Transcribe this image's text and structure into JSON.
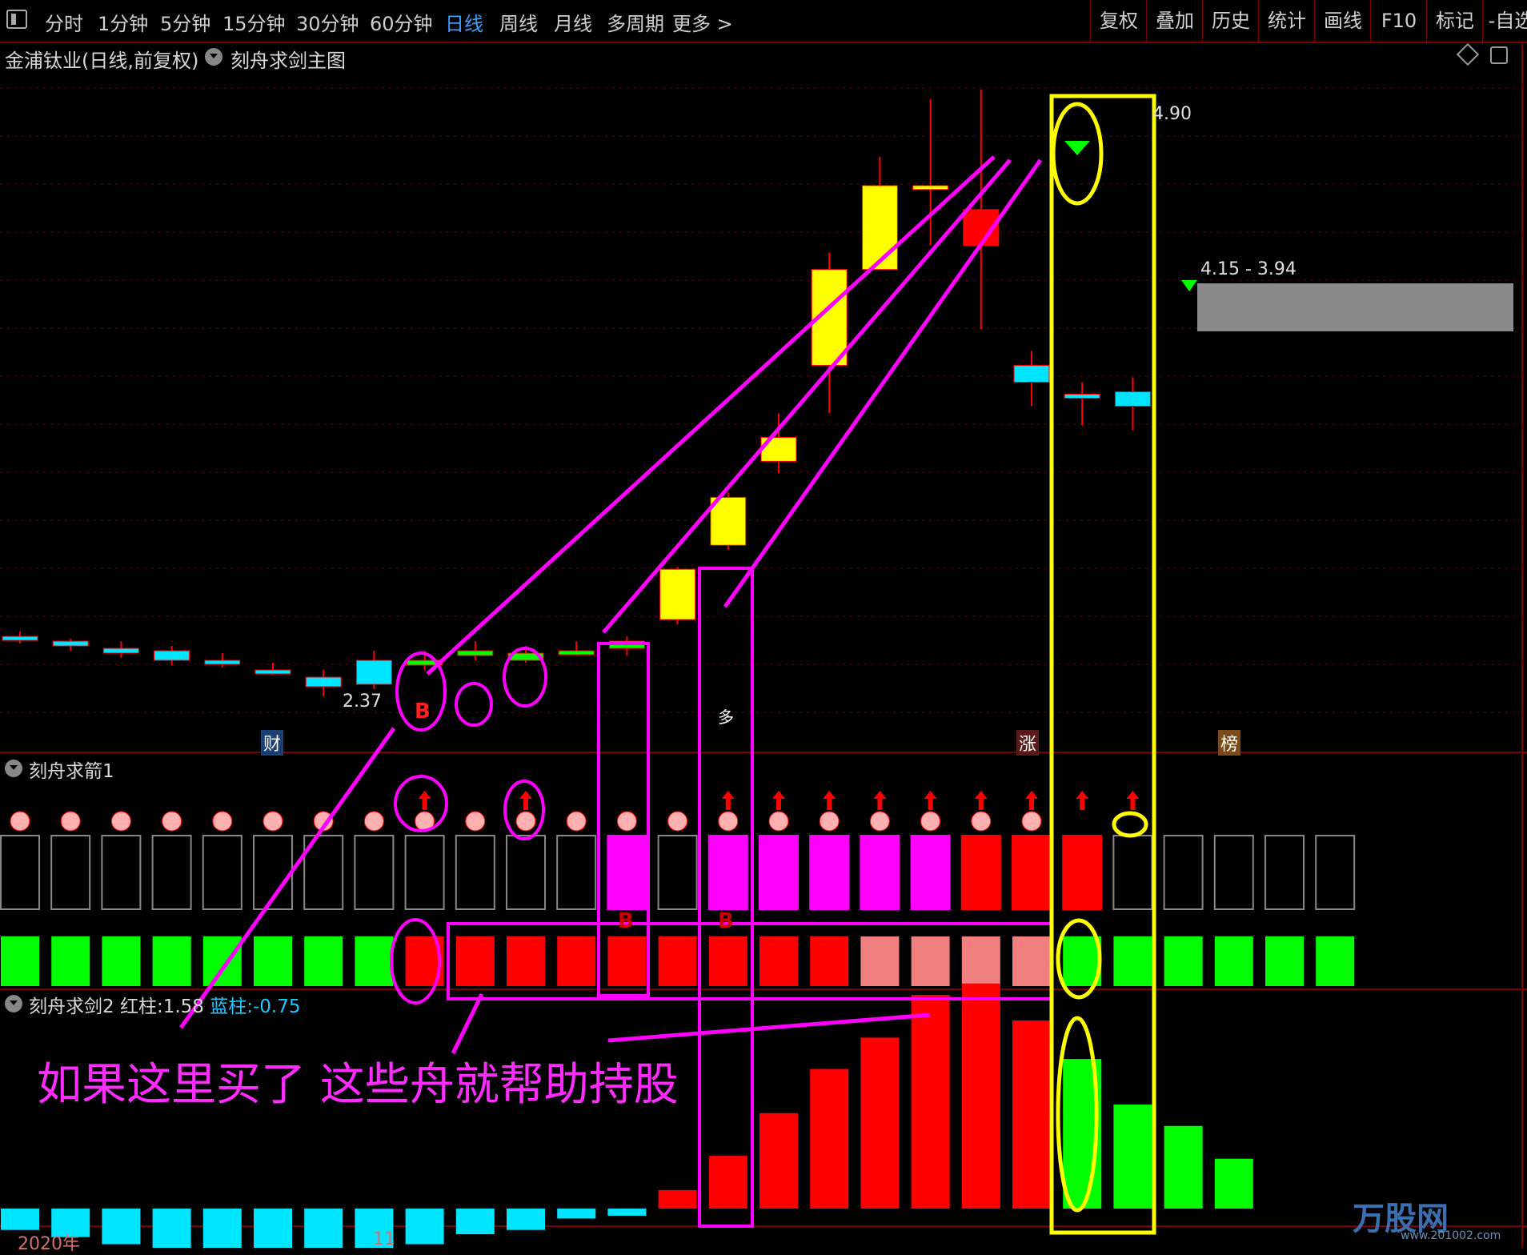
{
  "toolbar": {
    "periods": [
      "分时",
      "1分钟",
      "5分钟",
      "15分钟",
      "30分钟",
      "60分钟",
      "日线",
      "周线",
      "月线",
      "多周期",
      "更多 >"
    ],
    "active_period": "日线",
    "right_items": [
      "复权",
      "叠加",
      "历史",
      "统计",
      "画线",
      "F10",
      "标记",
      "-自选"
    ]
  },
  "main_chart": {
    "stock_title": "金浦钛业(日线,前复权)",
    "indicator_title": "刻舟求剑主图",
    "high_label": "4.90",
    "low_label": "2.37",
    "zone_label": "4.15 - 3.94",
    "tags": [
      "财",
      "涨",
      "榜"
    ],
    "signal_b": "B",
    "signal_duo": "多"
  },
  "sub1": {
    "title": "刻舟求箭1",
    "b_labels": [
      "B",
      "B"
    ]
  },
  "sub2": {
    "title": "刻舟求剑2",
    "red_label": "红柱:",
    "red_value": "1.58",
    "blue_label": "蓝柱:",
    "blue_value": "-0.75"
  },
  "annotation_text": "如果这里买了 这些舟就帮助持股",
  "x_axis": {
    "year": "2020年",
    "month": "11"
  },
  "watermark": {
    "brand": "万股网",
    "url": "www.201002.com"
  },
  "colors": {
    "bg": "#000000",
    "red": "#ff0000",
    "yellow": "#ffff00",
    "green": "#00ff00",
    "magenta": "#ff00ff",
    "cyan": "#00e5ff",
    "blue": "#0000ff",
    "pink": "#f08080",
    "grid": "#7a0000"
  },
  "chart_data": {
    "type": "candlestick",
    "series": [
      {
        "name": "candles",
        "o": [
          2.62,
          2.6,
          2.57,
          2.56,
          2.52,
          2.48,
          2.45,
          2.42,
          2.5,
          2.54,
          2.52,
          2.56,
          2.6,
          2.9,
          3.2,
          3.35,
          3.75,
          4.15,
          4.5,
          4.25,
          3.75,
          3.62,
          3.64
        ],
        "c": [
          2.62,
          2.58,
          2.55,
          2.52,
          2.51,
          2.48,
          2.41,
          2.52,
          2.52,
          2.56,
          2.55,
          2.56,
          2.57,
          2.69,
          3.0,
          3.45,
          4.15,
          4.5,
          4.5,
          4.4,
          3.68,
          3.63,
          3.58
        ],
        "h": [
          2.64,
          2.61,
          2.6,
          2.58,
          2.55,
          2.51,
          2.48,
          2.56,
          2.56,
          2.6,
          2.58,
          2.6,
          2.62,
          2.91,
          3.22,
          3.55,
          4.22,
          4.62,
          4.86,
          4.9,
          3.81,
          3.68,
          3.7
        ],
        "l": [
          2.59,
          2.56,
          2.53,
          2.5,
          2.49,
          2.46,
          2.37,
          2.4,
          2.48,
          2.52,
          2.51,
          2.54,
          2.54,
          2.67,
          2.98,
          3.3,
          3.55,
          4.2,
          4.25,
          3.9,
          3.58,
          3.5,
          3.48
        ]
      },
      {
        "name": "sub2",
        "values": [
          -0.15,
          -0.2,
          -0.25,
          -0.3,
          -0.3,
          -0.35,
          -0.4,
          -0.3,
          -0.25,
          -0.18,
          -0.15,
          -0.07,
          -0.05,
          0.13,
          0.37,
          0.67,
          0.98,
          1.2,
          1.5,
          1.58,
          1.32,
          1.05,
          0.73,
          0.58,
          0.35
        ]
      }
    ]
  }
}
